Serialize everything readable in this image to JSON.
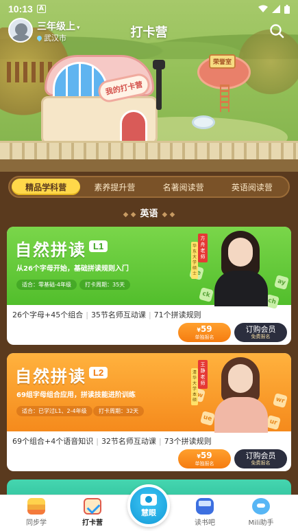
{
  "status_bar": {
    "time": "10:13",
    "notification_badge": "A",
    "icons": [
      "wifi-icon",
      "signal-icon",
      "battery-icon"
    ]
  },
  "header": {
    "grade": "三年级上",
    "city": "武汉市",
    "title": "打卡营",
    "icons": [
      "avatar",
      "location-pin-icon",
      "search-icon"
    ]
  },
  "scene": {
    "building_sign": "我的打卡营",
    "honor_sign": "荣誉室"
  },
  "tabs": [
    {
      "label": "精品学科营",
      "active": true
    },
    {
      "label": "素养提升营",
      "active": false
    },
    {
      "label": "名著阅读营",
      "active": false
    },
    {
      "label": "英语阅读营",
      "active": false
    }
  ],
  "section_title": "英语",
  "courses": [
    {
      "name": "自然拼读",
      "level": "L1",
      "subtitle": "从26个字母开始，基础拼读规则入门",
      "chip_age": "适合：零基础-4年级",
      "chip_cycle": "打卡周期：35天",
      "teacher_name": "方舟老师",
      "teacher_school": "华东大学硕士",
      "desc": [
        "26个字母+45个组合",
        "35节名师互动课",
        "71个拼读规则"
      ],
      "price_symbol": "¥",
      "price": "59",
      "price_sub": "单独报名",
      "member_label": "订购会员",
      "member_sub": "免费报名",
      "deco_letters": [
        "ee",
        "ck",
        "ay",
        "ch"
      ],
      "theme_color": "#52be2c"
    },
    {
      "name": "自然拼读",
      "level": "L2",
      "subtitle": "69组字母组合应用，拼读技能进阶训练",
      "chip_age": "适合：已学过L1、2-4年级",
      "chip_cycle": "打卡周期：32天",
      "teacher_name": "王静老师",
      "teacher_school": "清华大学本硕",
      "desc": [
        "69个组合+4个语音知识",
        "32节名师互动课",
        "73个拼读规则"
      ],
      "price_symbol": "¥",
      "price": "59",
      "price_sub": "单独报名",
      "member_label": "订购会员",
      "member_sub": "免费报名",
      "deco_letters": [
        "ew",
        "ue",
        "wr",
        "ur"
      ],
      "theme_color": "#f58a1c"
    }
  ],
  "bottom_nav": {
    "items": [
      {
        "label": "同步学",
        "icon": "books-icon",
        "active": false
      },
      {
        "label": "打卡营",
        "icon": "calendar-check-icon",
        "active": true
      },
      {
        "label": "读书吧",
        "icon": "bus-icon",
        "active": false
      },
      {
        "label": "Mili助手",
        "icon": "mascot-icon",
        "active": false
      }
    ],
    "camera_label": "慧眼"
  }
}
